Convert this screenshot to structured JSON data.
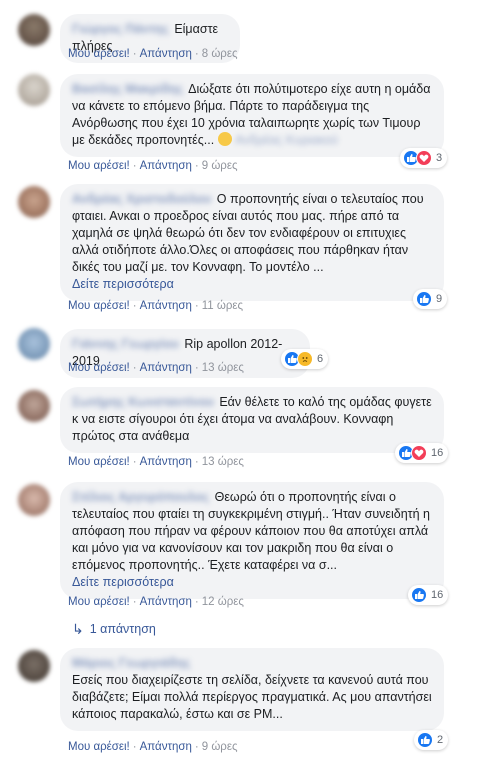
{
  "actions": {
    "like": "Μου αρέσει!",
    "reply": "Απάντηση",
    "sep": "·"
  },
  "see_more": "Δείτε περισσότερα",
  "comments": [
    {
      "name": "Γιώργος Πάντης",
      "text": "Είμαστε πλήρες",
      "time": "8 ώρες",
      "reactions": null
    },
    {
      "name": "Βασίλης Μακρίδης",
      "text": "Διώξατε ότι πολύτιμοτερο είχε αυτη η ομάδα να κάνετε το επόμενο βήμα. Πάρτε το παράδειγμα της Ανόρθωσης που έχει 10 χρόνια ταλαιπωρητε χωρίς των Τιμουρ με δεκάδες προπονητές...",
      "tail": "Ανδρέας Κυριακού",
      "time": "9 ώρες",
      "reactions": {
        "types": [
          "like",
          "love"
        ],
        "count": "3"
      }
    },
    {
      "name": "Ανδρέας Χριστοδούλου",
      "text": "Ο προπονητής είναι ο τελευταίος που φταιει. Ανκαι ο προεδρος είναι αυτός που μας. πήρε από τα χαμηλά σε ψηλά θεωρώ ότι δεν τον ενδιαφέρουν οι επιτυχιες αλλά οτιδήποτε άλλο.Όλες οι αποφάσεις που πάρθηκαν ήταν δικές του μαζί με. τον Κονναφη. Το μοντέλο ...",
      "see_more": true,
      "time": "11 ώρες",
      "reactions": {
        "types": [
          "like"
        ],
        "count": "9"
      }
    },
    {
      "name": "Γιάννης Γεωργίου",
      "text": "Rip apollon 2012-2019",
      "time": "13 ώρες",
      "reactions": {
        "types": [
          "like",
          "sad"
        ],
        "count": "6"
      }
    },
    {
      "name": "Σωτήρης Κωνσταντίνου",
      "text": "Εάν θέλετε το καλό της ομάδας φυγετε κ να ειστε σίγουροι ότι έχει άτομα να αναλάβουν. Κονναφη πρώτος στα ανάθεμα",
      "time": "13 ώρες",
      "reactions": {
        "types": [
          "like",
          "love"
        ],
        "count": "16"
      }
    },
    {
      "name": "Στέλιος Αργυρόπουλος",
      "text": "Θεωρώ ότι ο προπονητής είναι ο τελευταίος που φταίει τη συγκεκριμένη στιγμή.. Ήταν συνειδητή η απόφαση που πήραν να φέρουν κάποιον που θα αποτύχει απλά και μόνο για να κανονίσουν και τον μακριδη που θα είναι ο επόμενος προπονητής.. Έχετε καταφέρει να σ...",
      "see_more": true,
      "time": "12 ώρες",
      "reactions": {
        "types": [
          "like"
        ],
        "count": "16"
      }
    },
    {
      "name": "Μάριος Γεωργιάδης",
      "text": "Εσείς που διαχειρίζεστε τη σελίδα, δείχνετε τα κανενού αυτά που διαβάζετε; Είμαι πολλά περίεργος πραγματικά. Ας μου απαντήσει κάποιος παρακαλώ, έστω και σε PM...",
      "time": "9 ώρες",
      "reactions": {
        "types": [
          "like"
        ],
        "count": "2"
      }
    }
  ],
  "reply_count": "1 απάντηση",
  "colors": {
    "link": "#385898",
    "bubble": "#f2f3f5",
    "like": "#1877f2",
    "love": "#f33e58",
    "sad": "#f7b928"
  }
}
